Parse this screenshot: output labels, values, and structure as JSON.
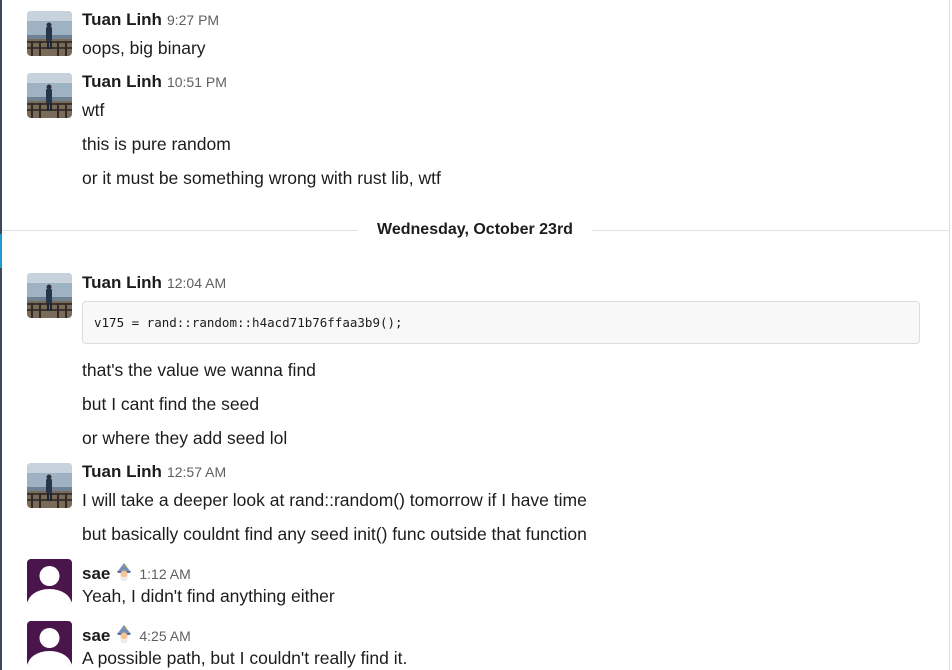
{
  "divider": {
    "label": "Wednesday, October 23rd"
  },
  "messages": [
    {
      "author": "Tuan Linh",
      "time": "9:27 PM",
      "lines": [
        "oops, big binary"
      ]
    },
    {
      "author": "Tuan Linh",
      "time": "10:51 PM",
      "lines": [
        "wtf",
        "this is pure random",
        "or it must be something wrong with rust lib, wtf"
      ]
    },
    {
      "author": "Tuan Linh",
      "time": "12:04 AM",
      "code": "v175 = rand::random::h4acd71b76ffaa3b9();",
      "lines": [
        "that's the value we wanna find",
        "but I cant find the seed",
        "or where they add seed lol"
      ]
    },
    {
      "author": "Tuan Linh",
      "time": "12:57 AM",
      "lines": [
        "I will take a deeper look at rand::random() tomorrow if I have time",
        "but basically couldnt find any seed init() func outside that function"
      ]
    },
    {
      "author": "sae",
      "emoji": "mage-emoji",
      "time": "1:12 AM",
      "lines": [
        "Yeah, I didn't find anything either"
      ]
    },
    {
      "author": "sae",
      "emoji": "mage-emoji",
      "time": "4:25 AM",
      "lines": [
        "A possible path, but I couldn't really find it."
      ]
    }
  ],
  "colors": {
    "sae_avatar": "#4a154b",
    "link_accent": "#1d9bd1",
    "timestamp": "#616061",
    "code_bg": "#f8f8f8"
  }
}
